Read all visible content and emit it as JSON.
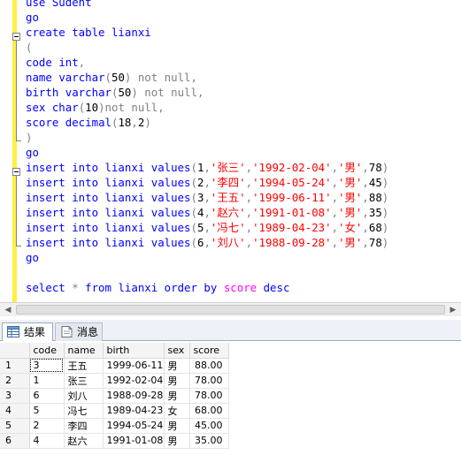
{
  "editor": {
    "lines": [
      [
        {
          "t": "use Sudent",
          "c": "kw"
        }
      ],
      [
        {
          "t": "go",
          "c": "kw"
        }
      ],
      [
        {
          "t": "create table lianxi",
          "c": "kw"
        }
      ],
      [
        {
          "t": "(",
          "c": "gr"
        }
      ],
      [
        {
          "t": "code ",
          "c": "kw"
        },
        {
          "t": "int",
          "c": "kw"
        },
        {
          "t": ",",
          "c": "gr"
        }
      ],
      [
        {
          "t": "name ",
          "c": "kw"
        },
        {
          "t": "varchar",
          "c": "kw"
        },
        {
          "t": "(",
          "c": "gr"
        },
        {
          "t": "50",
          "c": ""
        },
        {
          "t": ") ",
          "c": "gr"
        },
        {
          "t": "not null",
          "c": "gy"
        },
        {
          "t": ",",
          "c": "gr"
        }
      ],
      [
        {
          "t": "birth ",
          "c": "kw"
        },
        {
          "t": "varchar",
          "c": "kw"
        },
        {
          "t": "(",
          "c": "gr"
        },
        {
          "t": "50",
          "c": ""
        },
        {
          "t": ") ",
          "c": "gr"
        },
        {
          "t": "not null",
          "c": "gy"
        },
        {
          "t": ",",
          "c": "gr"
        }
      ],
      [
        {
          "t": "sex ",
          "c": "kw"
        },
        {
          "t": "char",
          "c": "kw"
        },
        {
          "t": "(",
          "c": "gr"
        },
        {
          "t": "10",
          "c": ""
        },
        {
          "t": ")",
          "c": "gr"
        },
        {
          "t": "not null",
          "c": "gy"
        },
        {
          "t": ",",
          "c": "gr"
        }
      ],
      [
        {
          "t": "score ",
          "c": "kw"
        },
        {
          "t": "decimal",
          "c": "kw"
        },
        {
          "t": "(",
          "c": "gr"
        },
        {
          "t": "18",
          "c": ""
        },
        {
          "t": ",",
          "c": "gr"
        },
        {
          "t": "2",
          "c": ""
        },
        {
          "t": ")",
          "c": "gr"
        }
      ],
      [
        {
          "t": ")",
          "c": "gr"
        }
      ],
      [
        {
          "t": "go",
          "c": "kw"
        }
      ],
      [
        {
          "t": "insert into lianxi values",
          "c": "kw"
        },
        {
          "t": "(",
          "c": "gr"
        },
        {
          "t": "1",
          "c": ""
        },
        {
          "t": ",",
          "c": "gr"
        },
        {
          "t": "'张三'",
          "c": "st"
        },
        {
          "t": ",",
          "c": "gr"
        },
        {
          "t": "'1992-02-04'",
          "c": "st"
        },
        {
          "t": ",",
          "c": "gr"
        },
        {
          "t": "'男'",
          "c": "st"
        },
        {
          "t": ",",
          "c": "gr"
        },
        {
          "t": "78",
          "c": ""
        },
        {
          "t": ")",
          "c": "gr"
        }
      ],
      [
        {
          "t": "insert into lianxi values",
          "c": "kw"
        },
        {
          "t": "(",
          "c": "gr"
        },
        {
          "t": "2",
          "c": ""
        },
        {
          "t": ",",
          "c": "gr"
        },
        {
          "t": "'李四'",
          "c": "st"
        },
        {
          "t": ",",
          "c": "gr"
        },
        {
          "t": "'1994-05-24'",
          "c": "st"
        },
        {
          "t": ",",
          "c": "gr"
        },
        {
          "t": "'男'",
          "c": "st"
        },
        {
          "t": ",",
          "c": "gr"
        },
        {
          "t": "45",
          "c": ""
        },
        {
          "t": ")",
          "c": "gr"
        }
      ],
      [
        {
          "t": "insert into lianxi values",
          "c": "kw"
        },
        {
          "t": "(",
          "c": "gr"
        },
        {
          "t": "3",
          "c": ""
        },
        {
          "t": ",",
          "c": "gr"
        },
        {
          "t": "'王五'",
          "c": "st"
        },
        {
          "t": ",",
          "c": "gr"
        },
        {
          "t": "'1999-06-11'",
          "c": "st"
        },
        {
          "t": ",",
          "c": "gr"
        },
        {
          "t": "'男'",
          "c": "st"
        },
        {
          "t": ",",
          "c": "gr"
        },
        {
          "t": "88",
          "c": ""
        },
        {
          "t": ")",
          "c": "gr"
        }
      ],
      [
        {
          "t": "insert into lianxi values",
          "c": "kw"
        },
        {
          "t": "(",
          "c": "gr"
        },
        {
          "t": "4",
          "c": ""
        },
        {
          "t": ",",
          "c": "gr"
        },
        {
          "t": "'赵六'",
          "c": "st"
        },
        {
          "t": ",",
          "c": "gr"
        },
        {
          "t": "'1991-01-08'",
          "c": "st"
        },
        {
          "t": ",",
          "c": "gr"
        },
        {
          "t": "'男'",
          "c": "st"
        },
        {
          "t": ",",
          "c": "gr"
        },
        {
          "t": "35",
          "c": ""
        },
        {
          "t": ")",
          "c": "gr"
        }
      ],
      [
        {
          "t": "insert into lianxi values",
          "c": "kw"
        },
        {
          "t": "(",
          "c": "gr"
        },
        {
          "t": "5",
          "c": ""
        },
        {
          "t": ",",
          "c": "gr"
        },
        {
          "t": "'冯七'",
          "c": "st"
        },
        {
          "t": ",",
          "c": "gr"
        },
        {
          "t": "'1989-04-23'",
          "c": "st"
        },
        {
          "t": ",",
          "c": "gr"
        },
        {
          "t": "'女'",
          "c": "st"
        },
        {
          "t": ",",
          "c": "gr"
        },
        {
          "t": "68",
          "c": ""
        },
        {
          "t": ")",
          "c": "gr"
        }
      ],
      [
        {
          "t": "insert into lianxi values",
          "c": "kw"
        },
        {
          "t": "(",
          "c": "gr"
        },
        {
          "t": "6",
          "c": ""
        },
        {
          "t": ",",
          "c": "gr"
        },
        {
          "t": "'刘八'",
          "c": "st"
        },
        {
          "t": ",",
          "c": "gr"
        },
        {
          "t": "'1988-09-28'",
          "c": "st"
        },
        {
          "t": ",",
          "c": "gr"
        },
        {
          "t": "'男'",
          "c": "st"
        },
        {
          "t": ",",
          "c": "gr"
        },
        {
          "t": "78",
          "c": ""
        },
        {
          "t": ")",
          "c": "gr"
        }
      ],
      [
        {
          "t": "go",
          "c": "kw"
        }
      ],
      [],
      [
        {
          "t": "select ",
          "c": "kw"
        },
        {
          "t": "* ",
          "c": "gr"
        },
        {
          "t": "from ",
          "c": "kw"
        },
        {
          "t": "lianxi ",
          "c": "kw"
        },
        {
          "t": "order by ",
          "c": "kw"
        },
        {
          "t": "score ",
          "c": "pk"
        },
        {
          "t": "desc",
          "c": "kw"
        }
      ]
    ]
  },
  "tabs": {
    "results_label": "结果",
    "messages_label": "消息"
  },
  "grid": {
    "columns": [
      "code",
      "name",
      "birth",
      "sex",
      "score"
    ],
    "rows": [
      {
        "rownum": "1",
        "code": "3",
        "name": "王五",
        "birth": "1999-06-11",
        "sex": "男",
        "score": "88.00"
      },
      {
        "rownum": "2",
        "code": "1",
        "name": "张三",
        "birth": "1992-02-04",
        "sex": "男",
        "score": "78.00"
      },
      {
        "rownum": "3",
        "code": "6",
        "name": "刘八",
        "birth": "1988-09-28",
        "sex": "男",
        "score": "78.00"
      },
      {
        "rownum": "4",
        "code": "5",
        "name": "冯七",
        "birth": "1989-04-23",
        "sex": "女",
        "score": "68.00"
      },
      {
        "rownum": "5",
        "code": "2",
        "name": "李四",
        "birth": "1994-05-24",
        "sex": "男",
        "score": "45.00"
      },
      {
        "rownum": "6",
        "code": "4",
        "name": "赵六",
        "birth": "1991-01-08",
        "sex": "男",
        "score": "35.00"
      }
    ]
  },
  "colors": {
    "keyword": "#0000ff",
    "operator": "#808080",
    "string": "#ff0000",
    "function": "#ff00ff",
    "change_bar": "#ffee44"
  },
  "icons": {
    "results_tab": "grid-icon",
    "messages_tab": "message-icon",
    "scroll_left": "scroll-left-arrow-icon",
    "scroll_right": "scroll-right-arrow-icon"
  }
}
